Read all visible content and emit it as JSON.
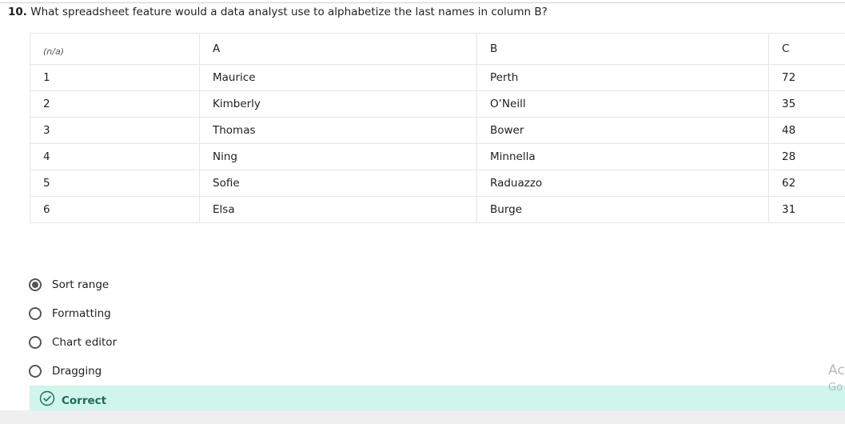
{
  "question": {
    "number": "10.",
    "text": "What spreadsheet feature would a data analyst use to alphabetize the last names in column B?"
  },
  "table": {
    "header": [
      "(n/a)",
      "A",
      "B",
      "C"
    ],
    "rows": [
      [
        "1",
        "Maurice",
        "Perth",
        "72"
      ],
      [
        "2",
        "Kimberly",
        "O’Neill",
        "35"
      ],
      [
        "3",
        "Thomas",
        "Bower",
        "48"
      ],
      [
        "4",
        "Ning",
        "Minnella",
        "28"
      ],
      [
        "5",
        "Sofie",
        "Raduazzo",
        "62"
      ],
      [
        "6",
        "Elsa",
        "Burge",
        "31"
      ]
    ]
  },
  "options": [
    {
      "label": "Sort range",
      "selected": true
    },
    {
      "label": "Formatting",
      "selected": false
    },
    {
      "label": "Chart editor",
      "selected": false
    },
    {
      "label": "Dragging",
      "selected": false
    }
  ],
  "feedback": {
    "label": "Correct",
    "icon": "check-circle-icon",
    "color": "#1e6b52",
    "background": "#cff5ec"
  },
  "watermark": {
    "line1": "Ac",
    "line2": "Go"
  }
}
